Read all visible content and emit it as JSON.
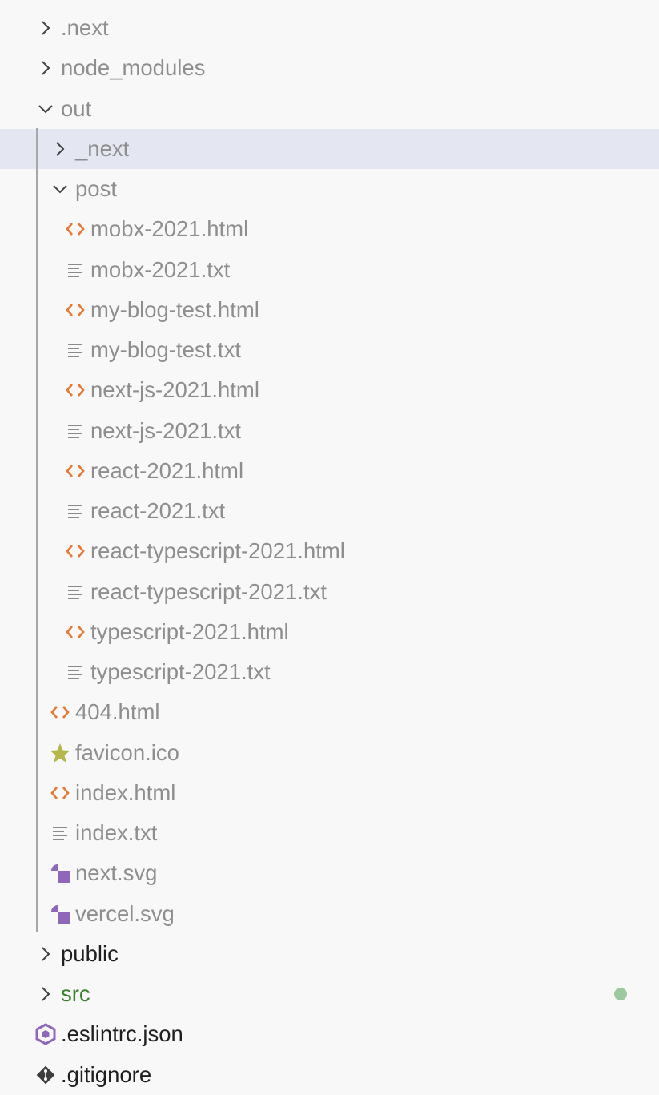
{
  "explorer": {
    "items": [
      {
        "label": ".next",
        "kind": "folder",
        "expanded": false,
        "depth": 0,
        "tone": "ignored"
      },
      {
        "label": "node_modules",
        "kind": "folder",
        "expanded": false,
        "depth": 0,
        "tone": "ignored"
      },
      {
        "label": "out",
        "kind": "folder",
        "expanded": true,
        "depth": 0,
        "tone": "ignored"
      },
      {
        "label": "_next",
        "kind": "folder",
        "expanded": false,
        "depth": 1,
        "tone": "ignored",
        "selected": true
      },
      {
        "label": "post",
        "kind": "folder",
        "expanded": true,
        "depth": 1,
        "tone": "ignored"
      },
      {
        "label": "mobx-2021.html",
        "kind": "html",
        "depth": 2,
        "tone": "ignored"
      },
      {
        "label": "mobx-2021.txt",
        "kind": "txt",
        "depth": 2,
        "tone": "ignored"
      },
      {
        "label": "my-blog-test.html",
        "kind": "html",
        "depth": 2,
        "tone": "ignored"
      },
      {
        "label": "my-blog-test.txt",
        "kind": "txt",
        "depth": 2,
        "tone": "ignored"
      },
      {
        "label": "next-js-2021.html",
        "kind": "html",
        "depth": 2,
        "tone": "ignored"
      },
      {
        "label": "next-js-2021.txt",
        "kind": "txt",
        "depth": 2,
        "tone": "ignored"
      },
      {
        "label": "react-2021.html",
        "kind": "html",
        "depth": 2,
        "tone": "ignored"
      },
      {
        "label": "react-2021.txt",
        "kind": "txt",
        "depth": 2,
        "tone": "ignored"
      },
      {
        "label": "react-typescript-2021.html",
        "kind": "html",
        "depth": 2,
        "tone": "ignored"
      },
      {
        "label": "react-typescript-2021.txt",
        "kind": "txt",
        "depth": 2,
        "tone": "ignored"
      },
      {
        "label": "typescript-2021.html",
        "kind": "html",
        "depth": 2,
        "tone": "ignored"
      },
      {
        "label": "typescript-2021.txt",
        "kind": "txt",
        "depth": 2,
        "tone": "ignored"
      },
      {
        "label": "404.html",
        "kind": "html",
        "depth": 1,
        "tone": "ignored"
      },
      {
        "label": "favicon.ico",
        "kind": "ico",
        "depth": 1,
        "tone": "ignored"
      },
      {
        "label": "index.html",
        "kind": "html",
        "depth": 1,
        "tone": "ignored"
      },
      {
        "label": "index.txt",
        "kind": "txt",
        "depth": 1,
        "tone": "ignored"
      },
      {
        "label": "next.svg",
        "kind": "svg",
        "depth": 1,
        "tone": "ignored"
      },
      {
        "label": "vercel.svg",
        "kind": "svg",
        "depth": 1,
        "tone": "ignored"
      },
      {
        "label": "public",
        "kind": "folder",
        "expanded": false,
        "depth": 0,
        "tone": "dark"
      },
      {
        "label": "src",
        "kind": "folder",
        "expanded": false,
        "depth": 0,
        "tone": "modified",
        "badge": true
      },
      {
        "label": ".eslintrc.json",
        "kind": "eslint",
        "depth": 0,
        "tone": "dark"
      },
      {
        "label": ".gitignore",
        "kind": "git",
        "depth": 0,
        "tone": "dark"
      }
    ]
  },
  "icons": {
    "folder": "chevron-icon",
    "html": "html-code-icon",
    "txt": "text-lines-icon",
    "ico": "star-icon",
    "svg": "svg-shapes-icon",
    "eslint": "eslint-icon",
    "git": "git-icon"
  },
  "colors": {
    "selected_row": "#e4e6f1",
    "html_icon": "#e37933",
    "text_icon": "#8c8c8c",
    "star_icon": "#b5b74a",
    "svg_icon": "#8f67b9",
    "eslint_icon": "#8f67b9",
    "modified_text": "#38802b",
    "modified_dot": "#9ec99e"
  }
}
